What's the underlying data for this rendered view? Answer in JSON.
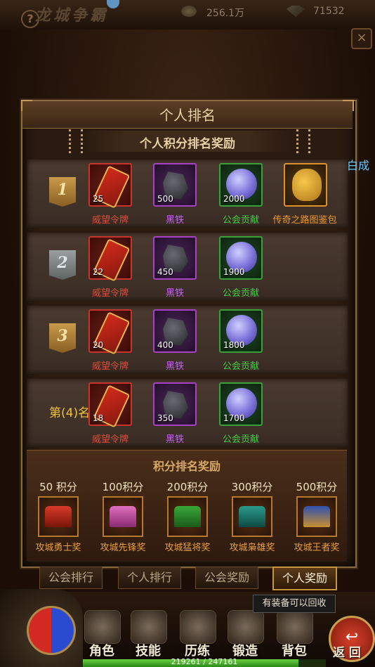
{
  "header": {
    "title": "龙城争霸",
    "gold": "256.1万",
    "gems": "71532"
  },
  "panel": {
    "title": "个人排名",
    "subtitle": "个人积分排名奖励"
  },
  "ranks": [
    {
      "rank": "1",
      "items": [
        {
          "qty": "25",
          "name": "威望令牌",
          "quality": "red",
          "icon": "token-icon"
        },
        {
          "qty": "500",
          "name": "黑铁",
          "quality": "purple",
          "icon": "ore-icon"
        },
        {
          "qty": "2000",
          "name": "公会贡献",
          "quality": "green",
          "icon": "orb-icon"
        },
        {
          "qty": "",
          "name": "传奇之路图鉴包",
          "quality": "orange",
          "icon": "bag-icon"
        }
      ]
    },
    {
      "rank": "2",
      "items": [
        {
          "qty": "22",
          "name": "威望令牌",
          "quality": "red",
          "icon": "token-icon"
        },
        {
          "qty": "450",
          "name": "黑铁",
          "quality": "purple",
          "icon": "ore-icon"
        },
        {
          "qty": "1900",
          "name": "公会贡献",
          "quality": "green",
          "icon": "orb-icon"
        }
      ]
    },
    {
      "rank": "3",
      "items": [
        {
          "qty": "20",
          "name": "威望令牌",
          "quality": "red",
          "icon": "token-icon"
        },
        {
          "qty": "400",
          "name": "黑铁",
          "quality": "purple",
          "icon": "ore-icon"
        },
        {
          "qty": "1800",
          "name": "公会贡献",
          "quality": "green",
          "icon": "orb-icon"
        }
      ]
    },
    {
      "rank": "第(4)名",
      "items": [
        {
          "qty": "18",
          "name": "威望令牌",
          "quality": "red",
          "icon": "token-icon"
        },
        {
          "qty": "350",
          "name": "黑铁",
          "quality": "purple",
          "icon": "ore-icon"
        },
        {
          "qty": "1700",
          "name": "公会贡献",
          "quality": "green",
          "icon": "orb-icon"
        }
      ]
    }
  ],
  "points_rewards": {
    "title": "积分排名奖励",
    "tiers": [
      {
        "points": "50 积分",
        "name": "攻城勇士奖",
        "icon": "red-chest-icon"
      },
      {
        "points": "100积分",
        "name": "攻城先锋奖",
        "icon": "pink-chest-icon"
      },
      {
        "points": "200积分",
        "name": "攻城猛将奖",
        "icon": "green-chest-icon"
      },
      {
        "points": "300积分",
        "name": "攻城枭雄奖",
        "icon": "teal-chest-icon"
      },
      {
        "points": "500积分",
        "name": "攻城王者奖",
        "icon": "gold-chest-icon"
      }
    ]
  },
  "tabs": [
    "公会排行",
    "个人排行",
    "公会奖励",
    "个人奖励"
  ],
  "active_tab": "个人奖励",
  "side_player_name": "冷月小白成",
  "tooltip": "有装备可以回收",
  "nav": [
    "角色",
    "技能",
    "历练",
    "锻造",
    "背包"
  ],
  "back_label": "返 回",
  "xp": {
    "text": "219261 / 247161",
    "fraction": 0.887
  }
}
